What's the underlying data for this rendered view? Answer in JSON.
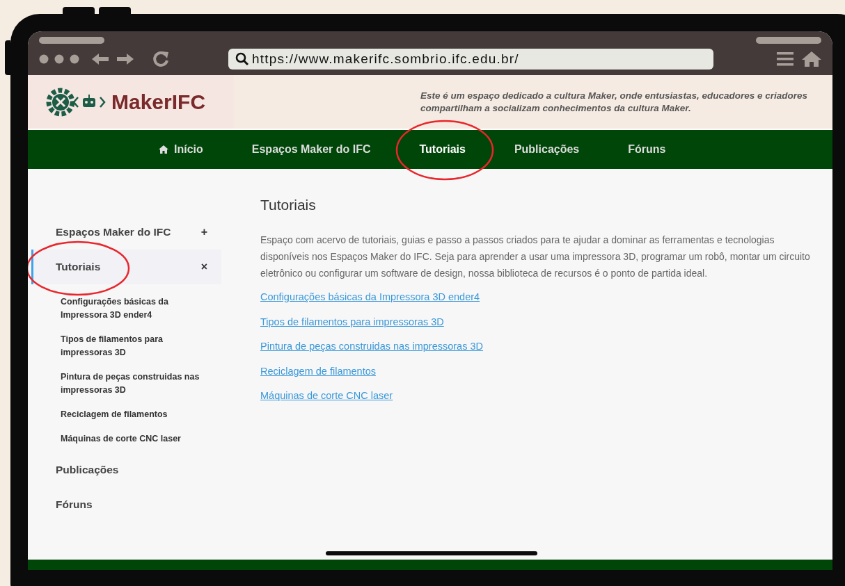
{
  "browser": {
    "url": "https://www.makerifc.sombrio.ifc.edu.br/"
  },
  "site": {
    "logo_text": "MakerIFC",
    "tagline": "Este é um espaço dedicado a cultura Maker, onde entusiastas, educadores e criadores compartilham a socializam conhecimentos da cultura Maker."
  },
  "nav": [
    {
      "label": "Início",
      "kind": "home",
      "selected": false,
      "circled": false
    },
    {
      "label": "Espaços Maker do IFC",
      "kind": "link",
      "selected": false,
      "circled": false
    },
    {
      "label": "Tutoriais",
      "kind": "link",
      "selected": true,
      "circled": true
    },
    {
      "label": "Publicações",
      "kind": "link",
      "selected": false,
      "circled": false
    },
    {
      "label": "Fóruns",
      "kind": "link",
      "selected": false,
      "circled": false
    }
  ],
  "sidebar": {
    "items": [
      {
        "label": "Espaços Maker do IFC",
        "selected": false,
        "toggle": "+",
        "circled": false
      },
      {
        "label": "Tutoriais",
        "selected": true,
        "toggle": "×",
        "circled": true,
        "children": [
          {
            "label": "Configurações básicas da Impressora 3D ender4"
          },
          {
            "label": "Tipos de filamentos para impressoras 3D"
          },
          {
            "label": "Pintura de peças construidas nas impressoras 3D"
          },
          {
            "label": "Reciclagem de filamentos"
          },
          {
            "label": "Máquinas de corte CNC laser"
          }
        ]
      },
      {
        "label": "Publicações",
        "selected": false,
        "circled": false
      },
      {
        "label": "Fóruns",
        "selected": false,
        "circled": false
      }
    ]
  },
  "content": {
    "title": "Tutoriais",
    "description": "Espaço com acervo de tutoriais, guias e passo a passos criados para te ajudar a dominar as ferramentas e tecnologias disponíveis nos Espaços Maker do IFC. Seja para aprender a usar uma impressora 3D, programar um robô, montar um circuito eletrônico ou configurar um software de design, nossa biblioteca de recursos é o ponto de partida ideal.",
    "links": [
      "Configurações básicas da Impressora 3D ender4",
      "Tipos de filamentos para impressoras 3D",
      "Pintura de peças construidas nas impressoras 3D",
      "Reciclagem de filamentos",
      "Máquinas de corte CNC laser"
    ]
  }
}
